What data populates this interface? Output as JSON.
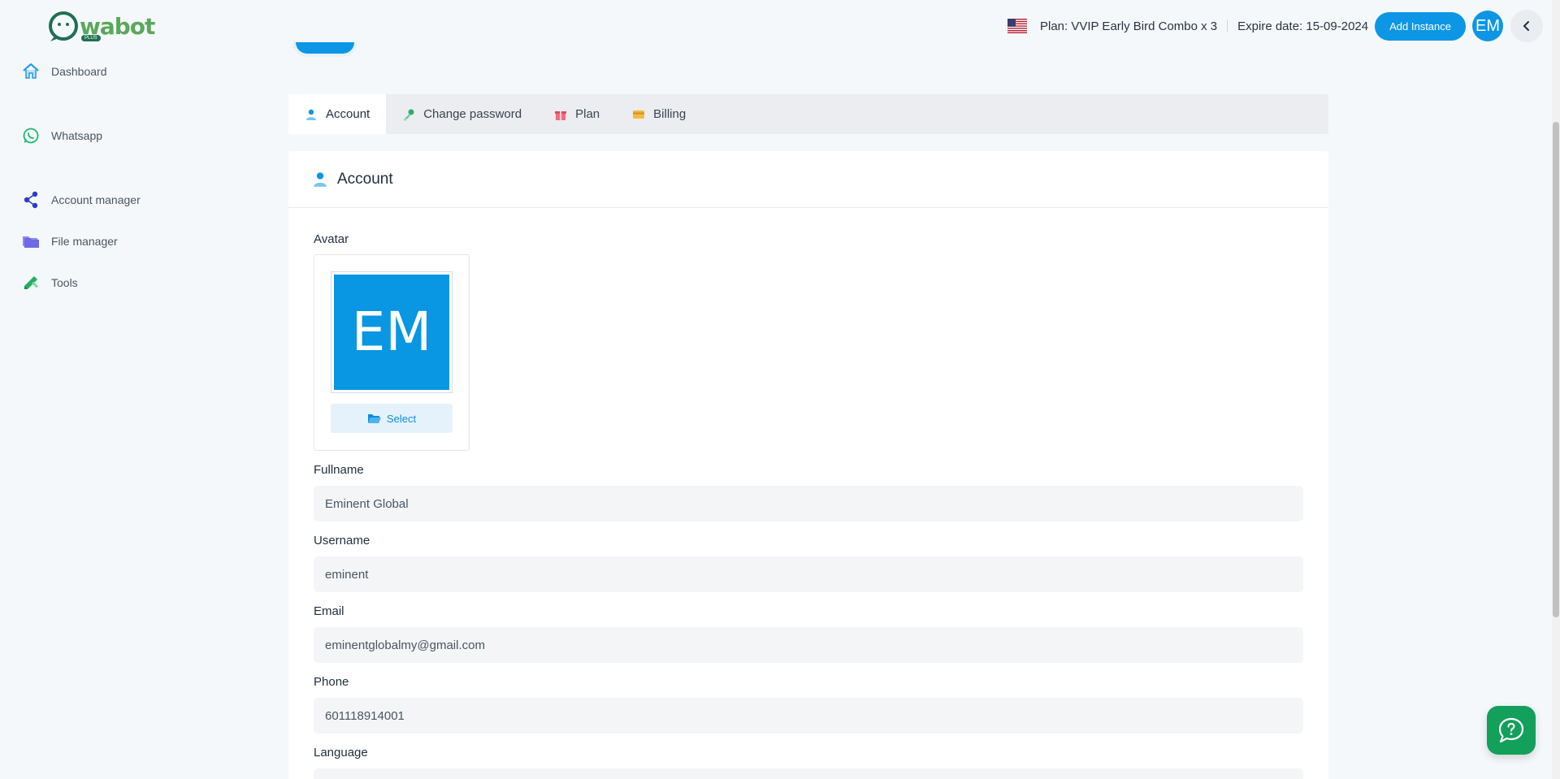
{
  "header": {
    "logo_text": "wabot",
    "logo_tag": "PLUS",
    "plan": "Plan: VVIP Early Bird Combo x 3",
    "expire": "Expire date: 15-09-2024",
    "add_instance_label": "Add Instance",
    "user_initials": "EM"
  },
  "sidebar": {
    "items": [
      {
        "label": "Dashboard",
        "icon": "home-icon"
      },
      {
        "label": "Whatsapp",
        "icon": "whatsapp-icon"
      },
      {
        "label": "Account manager",
        "icon": "share-nodes-icon"
      },
      {
        "label": "File manager",
        "icon": "folder-icon"
      },
      {
        "label": "Tools",
        "icon": "pencil-ruler-icon"
      }
    ]
  },
  "tabs": [
    {
      "label": "Account",
      "active": true
    },
    {
      "label": "Change password",
      "active": false
    },
    {
      "label": "Plan",
      "active": false
    },
    {
      "label": "Billing",
      "active": false
    }
  ],
  "account": {
    "title": "Account",
    "avatar_label": "Avatar",
    "avatar_initials": "EM",
    "select_label": "Select",
    "fullname_label": "Fullname",
    "fullname_value": "Eminent Global",
    "username_label": "Username",
    "username_value": "eminent",
    "email_label": "Email",
    "email_value": "eminentglobalmy@gmail.com",
    "phone_label": "Phone",
    "phone_value": "601118914001",
    "language_label": "Language"
  },
  "colors": {
    "primary": "#0d96e6",
    "sidebar_bg": "#f5f8fb",
    "help_fab": "#12a05a"
  }
}
